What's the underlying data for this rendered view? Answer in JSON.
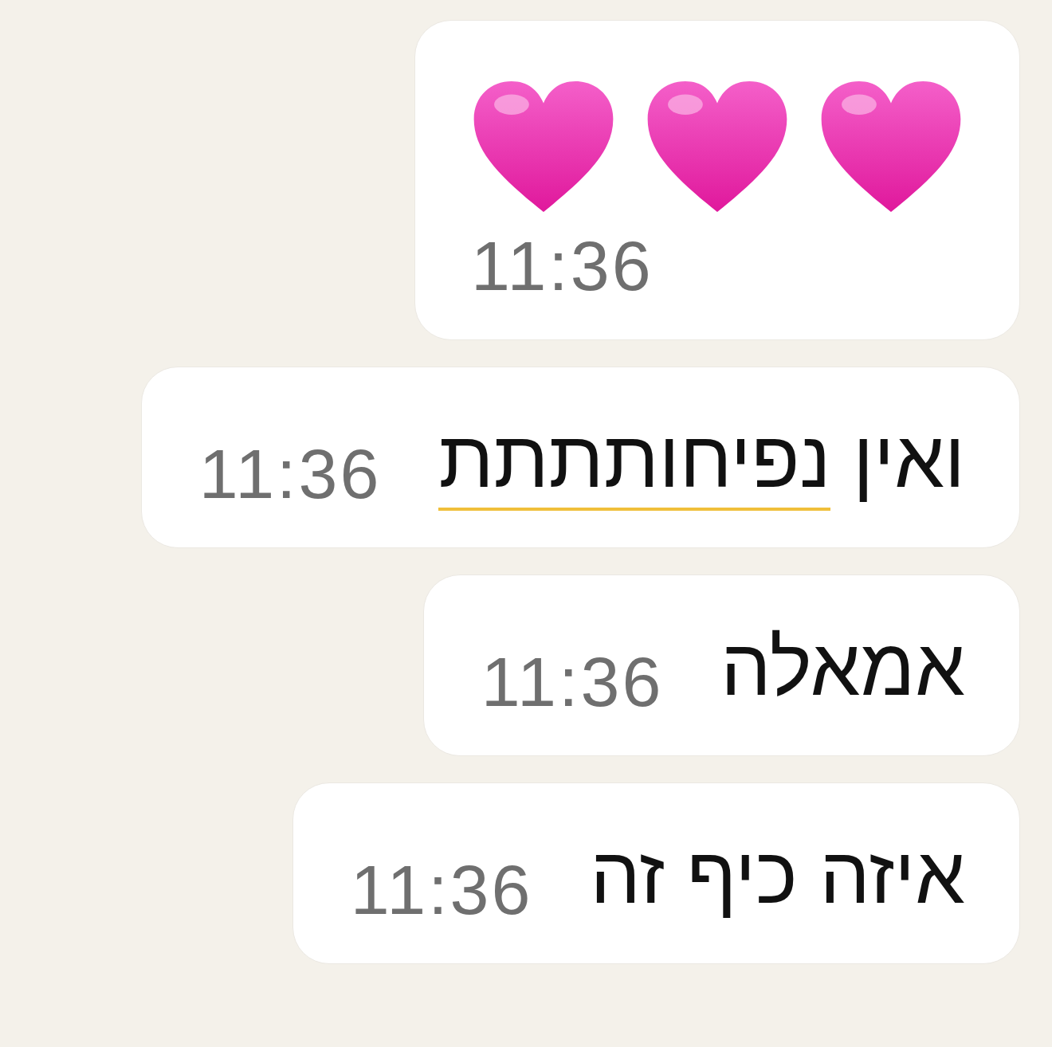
{
  "messages": [
    {
      "kind": "emoji",
      "content": [
        {
          "kind": "heart"
        },
        {
          "kind": "heart"
        },
        {
          "kind": "heart"
        }
      ],
      "time": "11:36"
    },
    {
      "kind": "text",
      "words": [
        {
          "text": "ואין",
          "flagged": false
        },
        {
          "text": "נפיחותתתת",
          "flagged": true
        }
      ],
      "time": "11:36"
    },
    {
      "kind": "text",
      "words": [
        {
          "text": "אמאלה",
          "flagged": false
        }
      ],
      "time": "11:36"
    },
    {
      "kind": "text",
      "words": [
        {
          "text": "איזה כיף זה",
          "flagged": false
        }
      ],
      "time": "11:36"
    }
  ]
}
